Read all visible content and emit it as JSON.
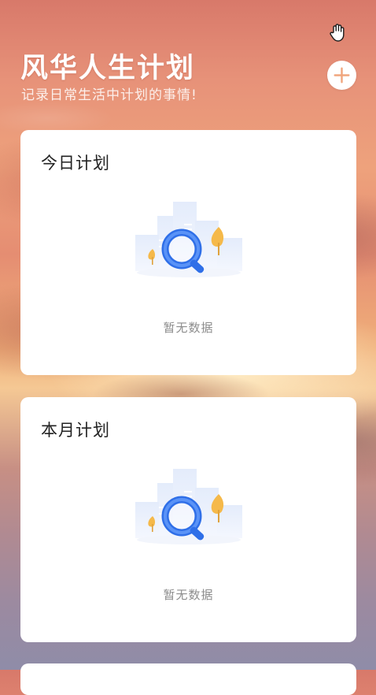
{
  "header": {
    "title": "风华人生计划",
    "subtitle": "记录日常生活中计划的事情!"
  },
  "icons": {
    "hand": "hand-icon",
    "add": "plus-icon",
    "empty": "magnifier-empty-icon"
  },
  "cards": {
    "today": {
      "title": "今日计划",
      "empty_text": "暂无数据"
    },
    "month": {
      "title": "本月计划",
      "empty_text": "暂无数据"
    }
  },
  "colors": {
    "accent": "#3d7cf2",
    "tree": "#f5b94a",
    "card_bg": "#ffffff"
  }
}
